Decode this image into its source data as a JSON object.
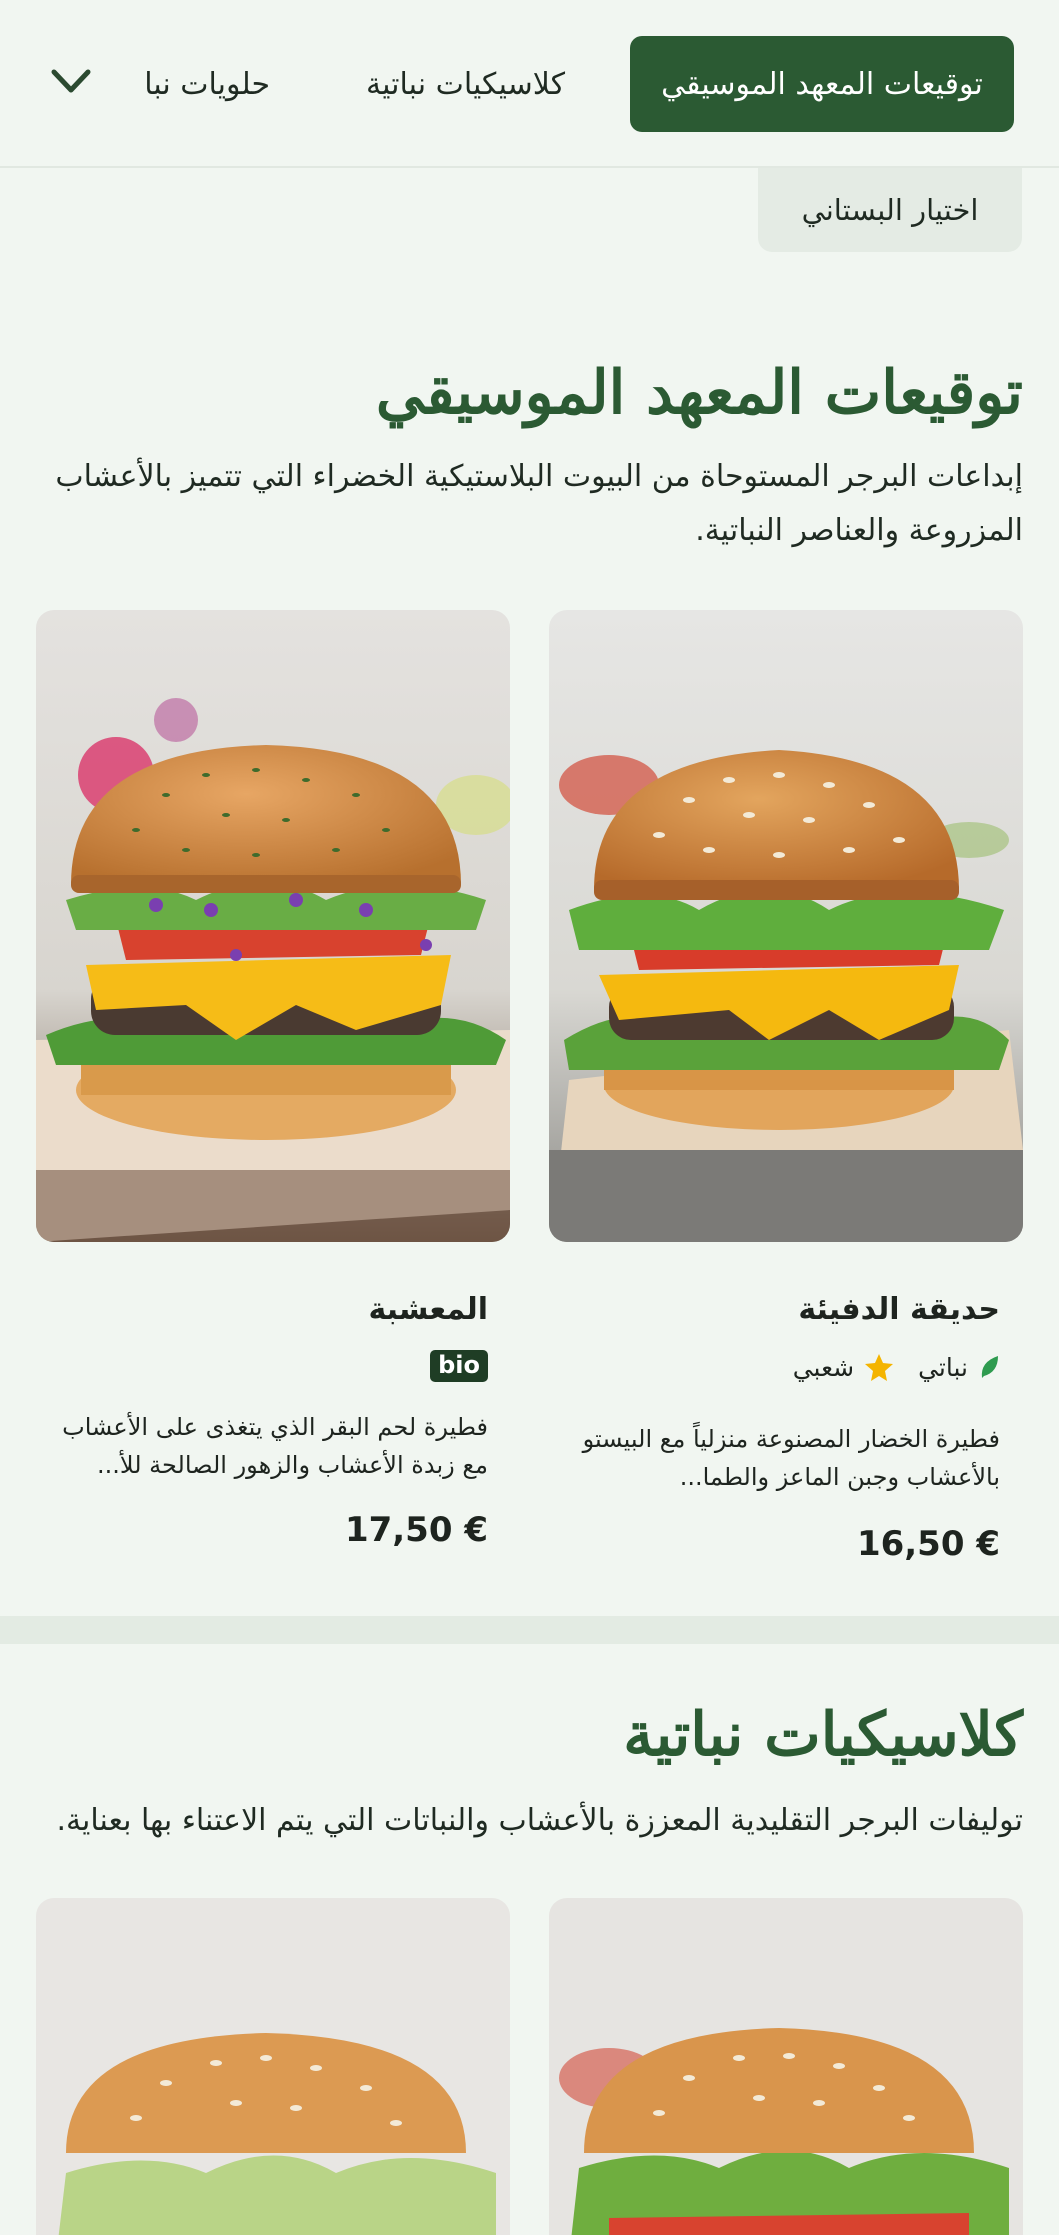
{
  "categories": {
    "tabs": [
      {
        "label": "توقيعات المعهد الموسيقي",
        "active": true
      },
      {
        "label": "كلاسيكيات نباتية",
        "active": false
      },
      {
        "label": "حلويات نبا",
        "active": false
      }
    ],
    "extra_chip": "اختيار البستاني",
    "more_icon": "chevron-down-icon"
  },
  "sections": [
    {
      "title": "توقيعات المعهد الموسيقي",
      "description": "إبداعات البرجر المستوحاة من البيوت البلاستيكية الخضراء التي تتميز بالأعشاب المزروعة والعناصر النباتية.",
      "products": [
        {
          "name": "حديقة الدفيئة",
          "tags": [
            {
              "icon": "leaf-icon",
              "label": "نباتي"
            },
            {
              "icon": "star-icon",
              "label": "شعبي"
            }
          ],
          "description": "فطيرة الخضار المصنوعة منزلياً مع البيستو بالأعشاب وجبن الماعز والطما...",
          "price": "16,50 €"
        },
        {
          "name": "المعشبة",
          "badge": "bio",
          "description": "فطيرة لحم البقر الذي يتغذى على الأعشاب مع زبدة الأعشاب والزهور الصالحة للأ...",
          "price": "17,50 €"
        }
      ]
    },
    {
      "title": "كلاسيكيات نباتية",
      "description": "توليفات البرجر التقليدية المعززة بالأعشاب والنباتات التي يتم الاعتناء بها بعناية."
    }
  ],
  "colors": {
    "accent": "#2b5a33",
    "background": "#f1f6f1",
    "leaf": "#2e9b4f",
    "star": "#f4b400"
  }
}
